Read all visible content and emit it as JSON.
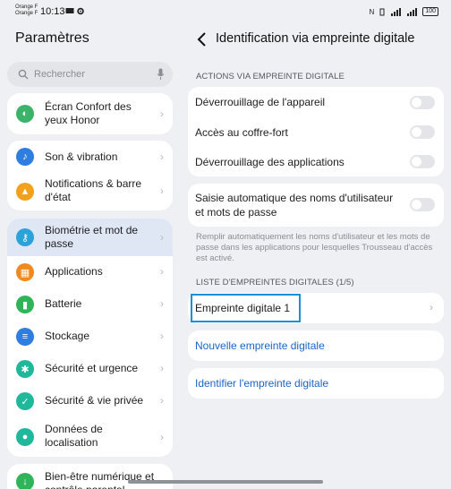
{
  "status_bar": {
    "carrier_1": "Orange F",
    "carrier_2": "Orange F",
    "time": "10:13",
    "battery": "100"
  },
  "left": {
    "title": "Paramètres",
    "search_placeholder": "Rechercher",
    "items": [
      {
        "label": "Écran Confort des yeux Honor",
        "icon": "eye-comfort-icon",
        "color": "#3bb46a"
      },
      {
        "label": "Son & vibration",
        "icon": "volume-icon",
        "color": "#2f7de1"
      },
      {
        "label": "Notifications & barre d'état",
        "icon": "bell-icon",
        "color": "#f2a11a"
      },
      {
        "label": "Biométrie et mot de passe",
        "icon": "key-icon",
        "color": "#2ba3d8"
      },
      {
        "label": "Applications",
        "icon": "apps-icon",
        "color": "#f08a1e"
      },
      {
        "label": "Batterie",
        "icon": "battery-icon",
        "color": "#2fb45a"
      },
      {
        "label": "Stockage",
        "icon": "storage-icon",
        "color": "#2f7de1"
      },
      {
        "label": "Sécurité et urgence",
        "icon": "emergency-icon",
        "color": "#1fb89b"
      },
      {
        "label": "Sécurité & vie privée",
        "icon": "privacy-icon",
        "color": "#1fb89b"
      },
      {
        "label": "Données de localisation",
        "icon": "location-icon",
        "color": "#1fb89b"
      },
      {
        "label": "Bien-être numérique et contrôle parental",
        "icon": "wellbeing-icon",
        "color": "#2fb45a"
      }
    ]
  },
  "right": {
    "title": "Identification via empreinte digitale",
    "section_actions": "ACTIONS VIA EMPREINTE DIGITALE",
    "actions": [
      {
        "label": "Déverrouillage de l'appareil",
        "on": false
      },
      {
        "label": "Accès au coffre-fort",
        "on": false
      },
      {
        "label": "Déverrouillage des applications",
        "on": false
      }
    ],
    "autofill_label": "Saisie automatique des noms d'utilisateur et mots de passe",
    "autofill_on": false,
    "autofill_hint": "Remplir automatiquement les noms d'utilisateur et les mots de passe dans les applications pour lesquelles Trousseau d'accès est activé.",
    "section_list": "LISTE D'EMPREINTES DIGITALES (1/5)",
    "fingerprint_1": "Empreinte digitale 1",
    "new_fingerprint": "Nouvelle empreinte digitale",
    "identify_fingerprint": "Identifier l'empreinte digitale"
  },
  "colors": {
    "accent": "#1a64c8",
    "highlight_border": "#1a90d8",
    "selected_row": "#dfe7f5"
  }
}
